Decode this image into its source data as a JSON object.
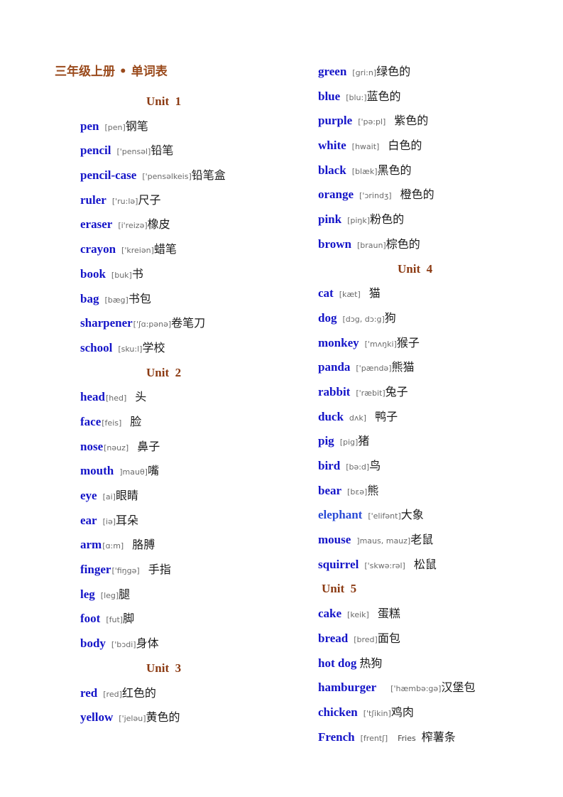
{
  "title": "三年级上册 • 单词表",
  "left_column": [
    {
      "type": "unit",
      "label": "Unit  1"
    },
    {
      "type": "word",
      "en": "pen",
      "ipa": "[pen]",
      "cn": "钢笔"
    },
    {
      "type": "word",
      "en": "pencil",
      "ipa": "['pensəl]",
      "cn": "铅笔"
    },
    {
      "type": "word",
      "en": "pencil-case",
      "ipa": "['pensəlkeis]",
      "cn": "铅笔盒"
    },
    {
      "type": "word",
      "en": "ruler",
      "ipa": "['ru:lə]",
      "cn": "尺子"
    },
    {
      "type": "word",
      "en": "eraser",
      "ipa": "[i'reizə]",
      "cn": "橡皮"
    },
    {
      "type": "word",
      "en": "crayon",
      "ipa": "['kreiən]",
      "cn": "蜡笔"
    },
    {
      "type": "word",
      "en": "book",
      "ipa": "[buk]",
      "cn": "书"
    },
    {
      "type": "word",
      "en": "bag",
      "ipa": "[bæg]",
      "cn": "书包"
    },
    {
      "type": "word",
      "en": "sharpener",
      "ipa": "['ʃɑ:pənə]",
      "cn": "卷笔刀",
      "tight": true
    },
    {
      "type": "word",
      "en": "school",
      "ipa": "[sku:l]",
      "cn": "学校"
    },
    {
      "type": "unit",
      "label": "Unit  2"
    },
    {
      "type": "word",
      "en": "head",
      "ipa": "[hed]",
      "cn": "头",
      "tight": true,
      "gap": true
    },
    {
      "type": "word",
      "en": "face",
      "ipa": "[feis]",
      "cn": "脸",
      "tight": true,
      "gap": true
    },
    {
      "type": "word",
      "en": "nose",
      "ipa": "[nəuz]",
      "cn": "鼻子",
      "tight": true,
      "gap": true
    },
    {
      "type": "word",
      "en": "mouth",
      "ipa": "]mauθ]",
      "cn": "嘴"
    },
    {
      "type": "word",
      "en": "eye",
      "ipa": "[ai]",
      "cn": "眼睛"
    },
    {
      "type": "word",
      "en": "ear",
      "ipa": "[iə]",
      "cn": "耳朵"
    },
    {
      "type": "word",
      "en": "arm",
      "ipa": "[ɑ:m]",
      "cn": "胳膊",
      "tight": true,
      "gap": true
    },
    {
      "type": "word",
      "en": "finger",
      "ipa": "['fiŋgə]",
      "cn": "手指",
      "tight": true,
      "gap": true
    },
    {
      "type": "word",
      "en": "leg",
      "ipa": "[leg]",
      "cn": "腿"
    },
    {
      "type": "word",
      "en": "foot",
      "ipa": "[fut]",
      "cn": "脚"
    },
    {
      "type": "word",
      "en": "body",
      "ipa": "['bɔdi]",
      "cn": "身体"
    },
    {
      "type": "unit",
      "label": "Unit  3"
    },
    {
      "type": "word",
      "en": "red",
      "ipa": "[red]",
      "cn": "红色的"
    },
    {
      "type": "word",
      "en": "yellow",
      "ipa": "['jeləu]",
      "cn": "黄色的"
    }
  ],
  "right_column": [
    {
      "type": "word",
      "en": "green",
      "ipa": "[gri:n]",
      "cn": "绿色的"
    },
    {
      "type": "word",
      "en": "blue",
      "ipa": "[blu:]",
      "cn": "蓝色的"
    },
    {
      "type": "word",
      "en": "purple",
      "ipa": "['pə:pl]",
      "cn": "紫色的",
      "gap": true
    },
    {
      "type": "word",
      "en": "white",
      "ipa": "[hwait]",
      "cn": "白色的",
      "gap": true
    },
    {
      "type": "word",
      "en": "black",
      "ipa": "[blæk]",
      "cn": "黑色的"
    },
    {
      "type": "word",
      "en": "orange",
      "ipa": "['ɔrindʒ]",
      "cn": "橙色的",
      "gap": true
    },
    {
      "type": "word",
      "en": "pink",
      "ipa": "[piŋk]",
      "cn": "粉色的"
    },
    {
      "type": "word",
      "en": "brown",
      "ipa": "[braun]",
      "cn": "棕色的"
    },
    {
      "type": "unit",
      "label": "Unit  4"
    },
    {
      "type": "word",
      "en": "cat",
      "ipa": "[kæt]",
      "cn": "猫",
      "gap": true
    },
    {
      "type": "word",
      "en": "dog",
      "ipa": "[dɔg, dɔ:g]",
      "cn": "狗"
    },
    {
      "type": "word",
      "en": "monkey",
      "ipa": "['mʌŋki]",
      "cn": "猴子"
    },
    {
      "type": "word",
      "en": "panda",
      "ipa": "['pændə]",
      "cn": "熊猫"
    },
    {
      "type": "word",
      "en": "rabbit",
      "ipa": "['ræbit]",
      "cn": "兔子"
    },
    {
      "type": "word",
      "en": "duck",
      "ipa": "dʌk]",
      "cn": "鸭子",
      "gap": true
    },
    {
      "type": "word",
      "en": "pig",
      "ipa": "[pig]",
      "cn": "猪"
    },
    {
      "type": "word",
      "en": "bird",
      "ipa": "[bə:d]",
      "cn": "鸟"
    },
    {
      "type": "word",
      "en": "bear",
      "ipa": "[bɛə]",
      "cn": "熊"
    },
    {
      "type": "word",
      "en": "elephant",
      "ipa": "['elifənt]",
      "cn": "大象",
      "light": true
    },
    {
      "type": "word",
      "en": "mouse",
      "ipa": "]maus, mauz]",
      "cn": "老鼠"
    },
    {
      "type": "word",
      "en": "squirrel",
      "ipa": "['skwə:rəl]",
      "cn": "松鼠",
      "gap": true
    },
    {
      "type": "unit",
      "label": "Unit  5",
      "short": true
    },
    {
      "type": "word",
      "en": "cake",
      "ipa": "[keik]",
      "cn": "蛋糕",
      "gap": true
    },
    {
      "type": "word",
      "en": "bread",
      "ipa": "[bred]",
      "cn": "面包"
    },
    {
      "type": "word",
      "en": "hot  dog",
      "ipa": "",
      "cn": "热狗"
    },
    {
      "type": "word",
      "en": "hamburger",
      "ipa": "['hæmbə:gə]",
      "cn": "汉堡包",
      "wide": true
    },
    {
      "type": "word",
      "en": "chicken",
      "ipa": "['tʃikin]",
      "cn": "鸡肉"
    },
    {
      "type": "word",
      "en": "French",
      "ipa": "[frentʃ]",
      "extra": "Fries",
      "cn": "榨薯条"
    }
  ]
}
